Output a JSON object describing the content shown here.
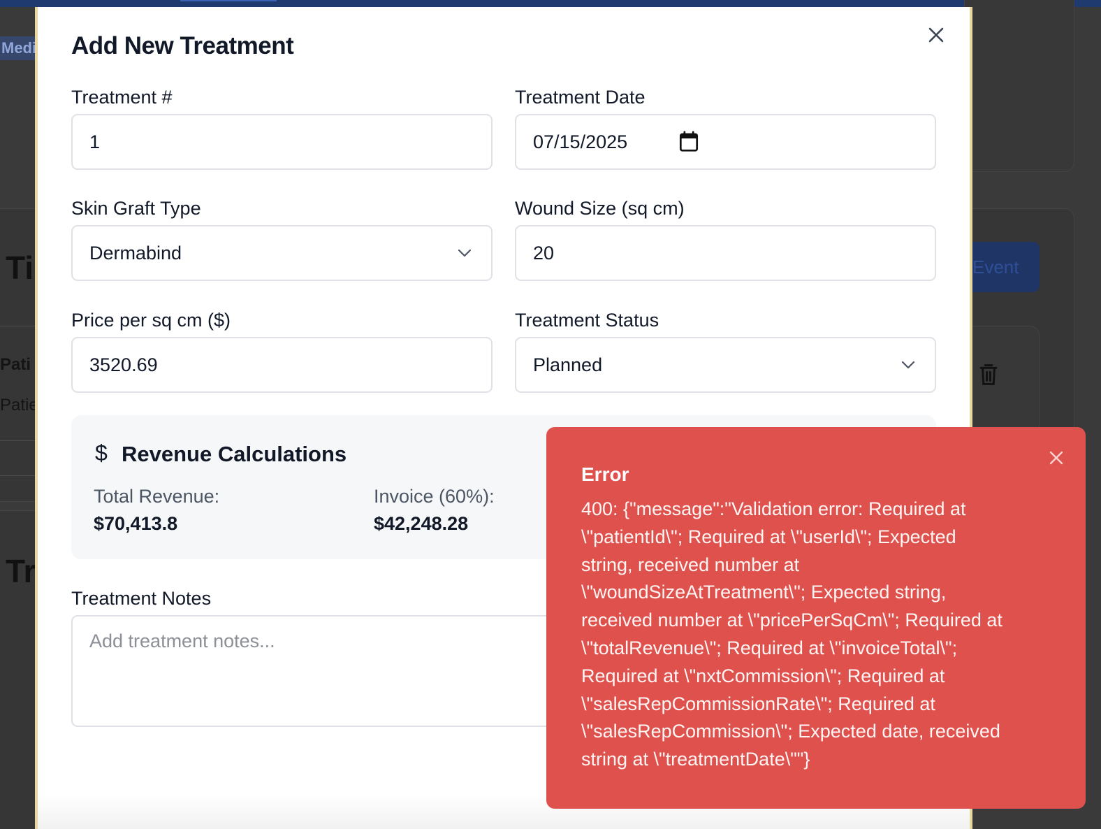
{
  "background": {
    "chip_text": "Medica",
    "heading_1": "Ti",
    "heading_2": "Tr",
    "col_label": "Pati",
    "row_label": "Patie",
    "event_button_label": "Event"
  },
  "modal": {
    "title": "Add New Treatment",
    "fields": {
      "treatment_number": {
        "label": "Treatment #",
        "value": "1"
      },
      "treatment_date": {
        "label": "Treatment Date",
        "value": "07/15/2025"
      },
      "skin_graft_type": {
        "label": "Skin Graft Type",
        "value": "Dermabind"
      },
      "wound_size": {
        "label": "Wound Size (sq cm)",
        "value": "20"
      },
      "price_per_sqcm": {
        "label": "Price per sq cm ($)",
        "value": "3520.69"
      },
      "treatment_status": {
        "label": "Treatment Status",
        "value": "Planned"
      }
    },
    "revenue": {
      "icon": "dollar-icon",
      "title": "Revenue Calculations",
      "total_label": "Total Revenue:",
      "total_value": "$70,413.8",
      "invoice_label": "Invoice (60%):",
      "invoice_value": "$42,248.28"
    },
    "notes": {
      "label": "Treatment Notes",
      "placeholder": "Add treatment notes..."
    }
  },
  "toast": {
    "title": "Error",
    "message": "400: {\"message\":\"Validation error: Required at\n\\\"patientId\\\"; Required at \\\"userId\\\"; Expected\nstring, received number at\n\\\"woundSizeAtTreatment\\\"; Expected string,\nreceived number at \\\"pricePerSqCm\\\"; Required at\n\\\"totalRevenue\\\"; Required at \\\"invoiceTotal\\\";\nRequired at \\\"nxtCommission\\\"; Required at\n\\\"salesRepCommissionRate\\\"; Required at\n\\\"salesRepCommission\\\"; Expected date, received\nstring at \\\"treatmentDate\\\"\"}",
    "background_color": "#df514c"
  },
  "colors": {
    "overlay": "#3a3a3a",
    "topbar": "#1e3a6e",
    "modal_border": "#e8d7a0"
  }
}
